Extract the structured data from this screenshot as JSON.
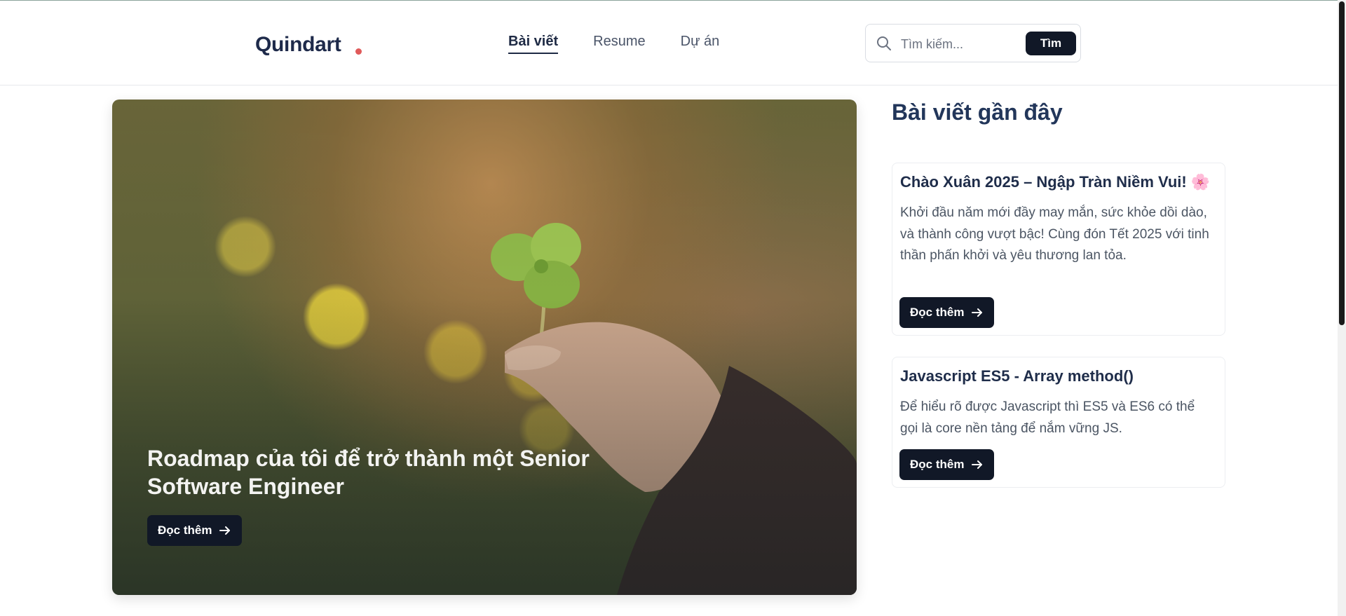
{
  "header": {
    "logo": "Quindart",
    "nav": [
      "Bài viết",
      "Resume",
      "Dự án"
    ],
    "search": {
      "placeholder": "Tìm kiếm...",
      "button_label": "Tìm"
    }
  },
  "hero": {
    "title": "Roadmap của tôi để trở thành một Senior Software Engineer",
    "button_label": "Đọc thêm"
  },
  "sidebar": {
    "title": "Bài viết gần đây",
    "posts": [
      {
        "title": "Chào Xuân 2025 – Ngập Tràn Niềm Vui! 🌸",
        "description": "Khởi đầu năm mới đầy may mắn, sức khỏe dồi dào, và thành công vượt bậc! Cùng đón Tết 2025 với tinh thần phấn khởi và yêu thương lan tỏa.",
        "button_label": "Đọc thêm"
      },
      {
        "title": "Javascript ES5 - Array method()",
        "description": "Để hiểu rõ được Javascript thì ES5 và ES6 có thể gọi là core nền tảng để nắm vững JS.",
        "button_label": "Đọc thêm"
      }
    ]
  },
  "colors": {
    "accent_dot": "#e05a5a",
    "button_bg": "#111827",
    "heading": "#22365a"
  }
}
